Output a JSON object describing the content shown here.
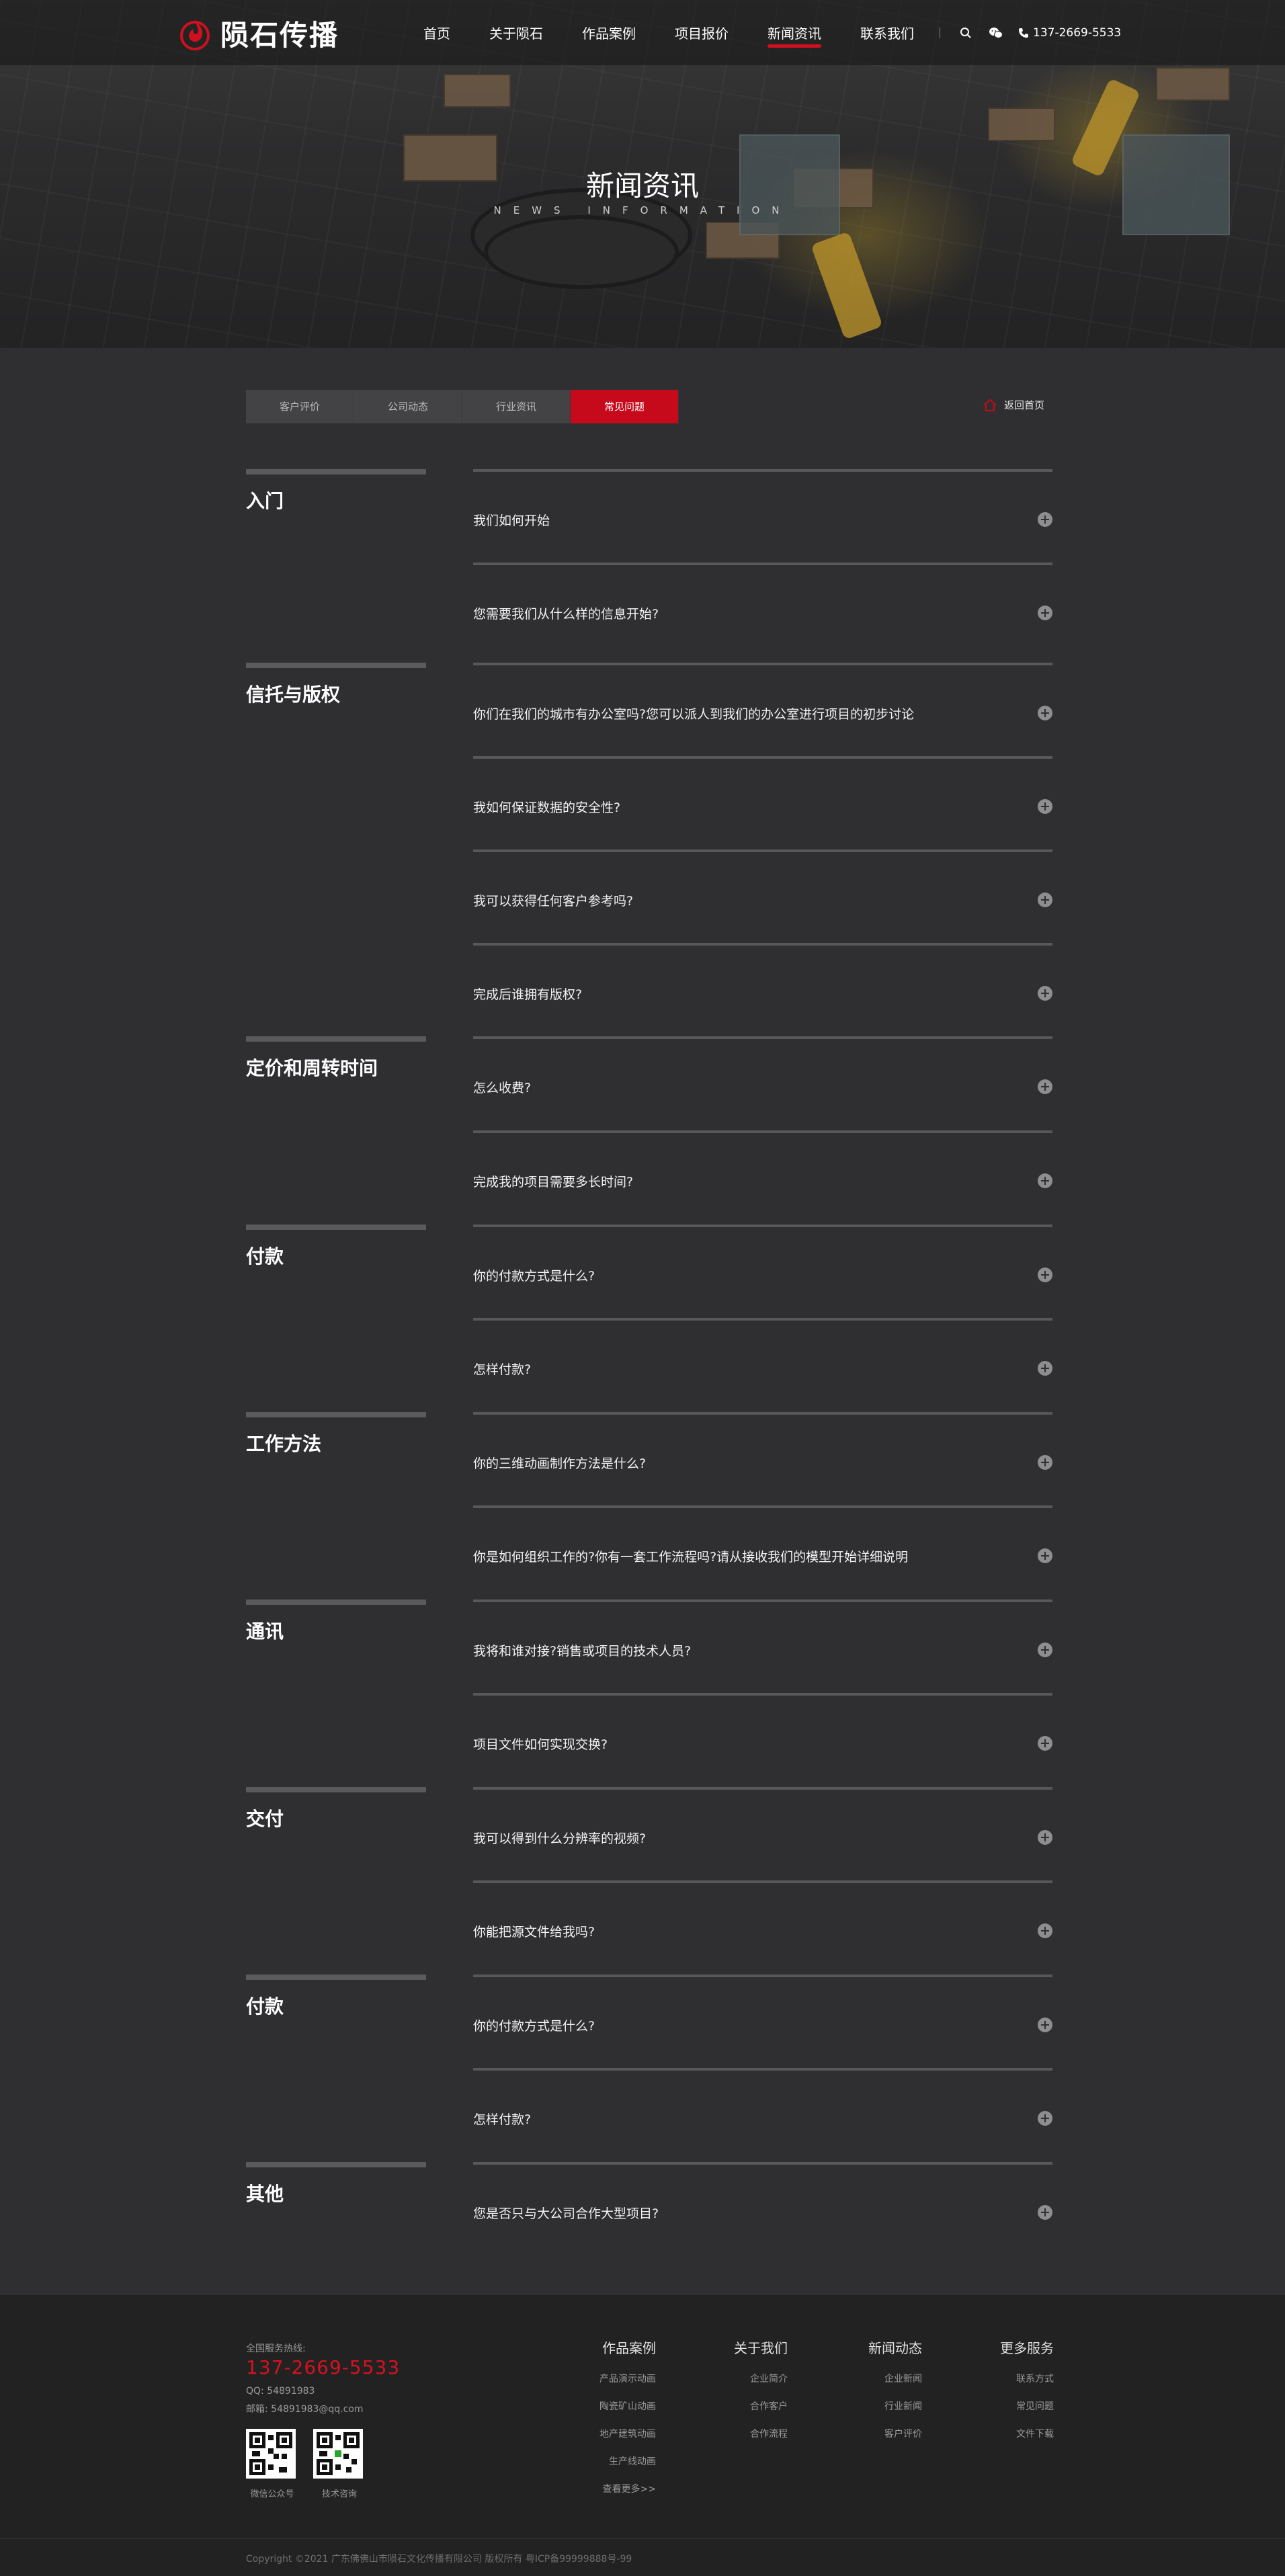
{
  "brand": {
    "name": "陨石传播",
    "accent": "#c70a1b"
  },
  "nav": {
    "items": [
      {
        "label": "首页",
        "active": false
      },
      {
        "label": "关于陨石",
        "active": false
      },
      {
        "label": "作品案例",
        "active": false
      },
      {
        "label": "项目报价",
        "active": false
      },
      {
        "label": "新闻资讯",
        "active": true
      },
      {
        "label": "联系我们",
        "active": false
      }
    ],
    "phone": "137-2669-5533",
    "search_icon": "search-icon",
    "wechat_icon": "wechat-icon"
  },
  "hero": {
    "title": "新闻资讯",
    "subtitle": "NEWS INFORMATION"
  },
  "tabs": [
    {
      "label": "客户评价",
      "active": false
    },
    {
      "label": "公司动态",
      "active": false
    },
    {
      "label": "行业资讯",
      "active": false
    },
    {
      "label": "常见问题",
      "active": true
    }
  ],
  "back_home": "返回首页",
  "categories": [
    {
      "name": "入门"
    },
    {
      "name": "信托与版权"
    },
    {
      "name": "定价和周转时间"
    },
    {
      "name": "付款"
    },
    {
      "name": "工作方法"
    },
    {
      "name": "通讯"
    },
    {
      "name": "交付"
    },
    {
      "name": "付款"
    },
    {
      "name": "其他"
    }
  ],
  "faqs": [
    {
      "q": "我们如何开始"
    },
    {
      "q": "您需要我们从什么样的信息开始?"
    },
    {
      "q": "你们在我们的城市有办公室吗?您可以派人到我们的办公室进行项目的初步讨论"
    },
    {
      "q": "我如何保证数据的安全性?"
    },
    {
      "q": "我可以获得任何客户参考吗?"
    },
    {
      "q": "完成后谁拥有版权?"
    },
    {
      "q": "怎么收费?"
    },
    {
      "q": "完成我的项目需要多长时间?"
    },
    {
      "q": "你的付款方式是什么?"
    },
    {
      "q": "怎样付款?"
    },
    {
      "q": "你的三维动画制作方法是什么?"
    },
    {
      "q": "你是如何组织工作的?你有一套工作流程吗?请从接收我们的模型开始详细说明"
    },
    {
      "q": "我将和谁对接?销售或项目的技术人员?"
    },
    {
      "q": "项目文件如何实现交换?"
    },
    {
      "q": "我可以得到什么分辨率的视频?"
    },
    {
      "q": "你能把源文件给我吗?"
    },
    {
      "q": "你的付款方式是什么?"
    },
    {
      "q": "怎样付款?"
    },
    {
      "q": "您是否只与大公司合作大型项目?"
    }
  ],
  "footer": {
    "hotline_label": "全国服务热线:",
    "hotline": "137-2669-5533",
    "qq": "QQ: 54891983",
    "email": "邮箱: 54891983@qq.com",
    "qr_codes": [
      {
        "caption": "微信公众号"
      },
      {
        "caption": "技术咨询"
      }
    ],
    "columns": [
      {
        "title": "作品案例",
        "links": [
          "产品演示动画",
          "陶瓷矿山动画",
          "地产建筑动画",
          "生产线动画",
          "查看更多>>"
        ]
      },
      {
        "title": "关于我们",
        "links": [
          "企业简介",
          "合作客户",
          "合作流程"
        ]
      },
      {
        "title": "新闻动态",
        "links": [
          "企业新闻",
          "行业新闻",
          "客户评价"
        ]
      },
      {
        "title": "更多服务",
        "links": [
          "联系方式",
          "常见问题",
          "文件下载"
        ]
      }
    ],
    "copyright": "Copyright ©2021 广东佛佛山市陨石文化传播有限公司 版权所有    粤ICP备99999888号-99"
  }
}
